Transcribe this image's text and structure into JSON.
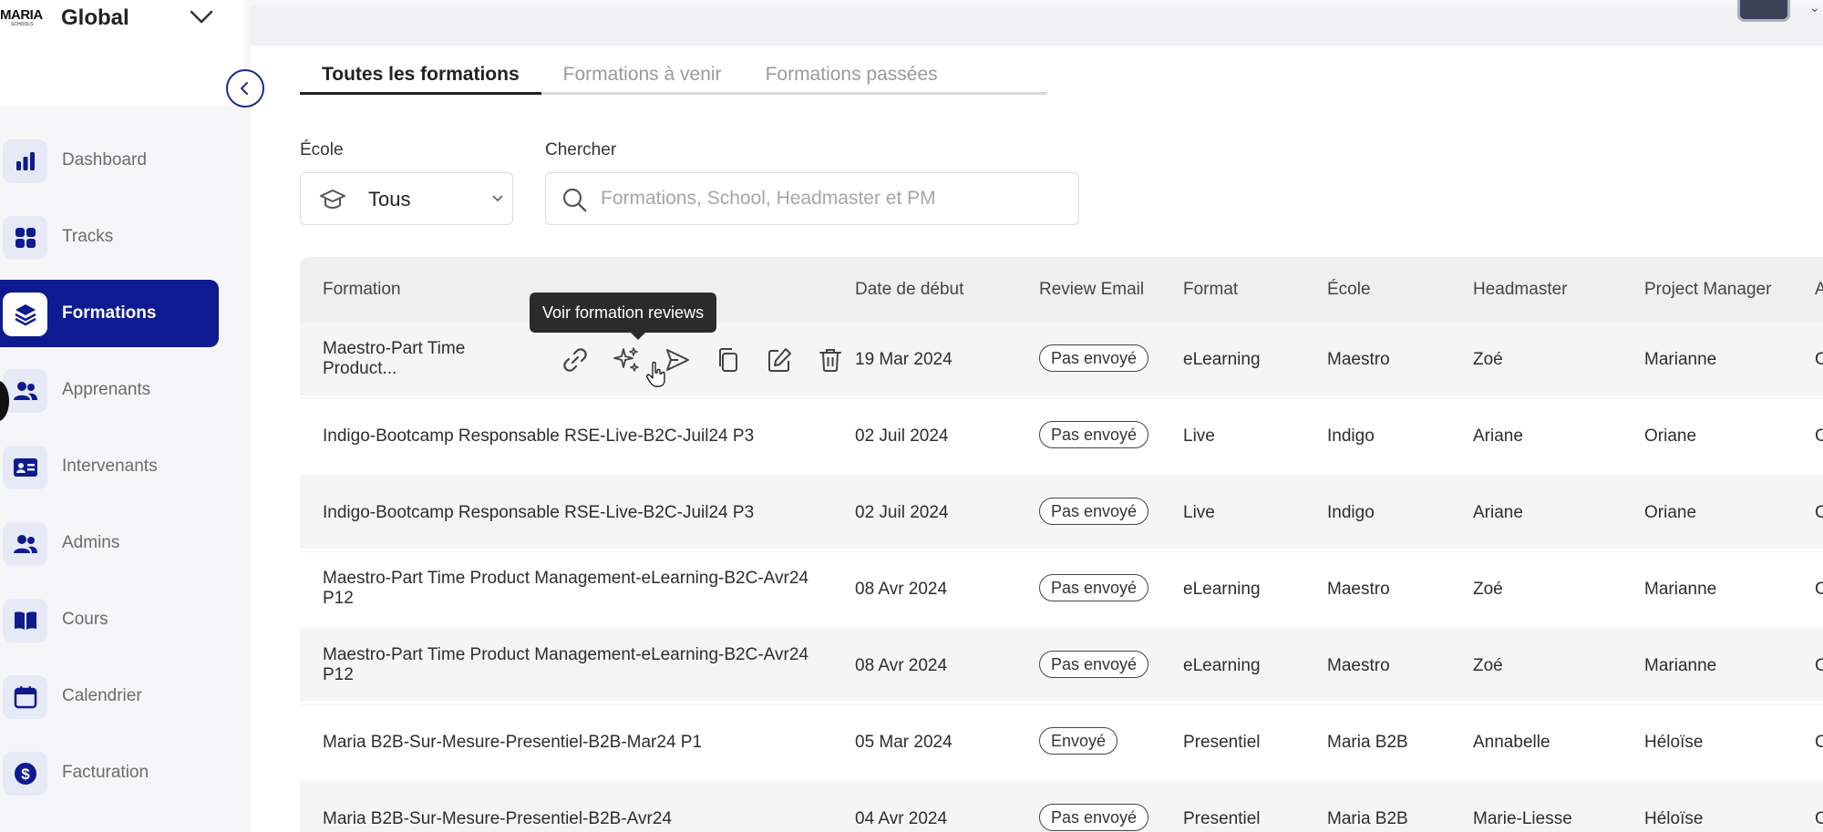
{
  "sidebar": {
    "logo": {
      "text": "MARIA",
      "subtext": "SCHOOLS"
    },
    "org_name": "Global",
    "items": [
      {
        "label": "Dashboard",
        "icon": "bar-chart-icon"
      },
      {
        "label": "Tracks",
        "icon": "grid-icon"
      },
      {
        "label": "Formations",
        "icon": "layers-icon",
        "active": true
      },
      {
        "label": "Apprenants",
        "icon": "users-icon"
      },
      {
        "label": "Intervenants",
        "icon": "id-card-icon"
      },
      {
        "label": "Admins",
        "icon": "users-icon"
      },
      {
        "label": "Cours",
        "icon": "book-icon"
      },
      {
        "label": "Calendrier",
        "icon": "calendar-icon"
      },
      {
        "label": "Facturation",
        "icon": "dollar-icon"
      }
    ]
  },
  "tabs": [
    {
      "label": "Toutes les formations",
      "active": true
    },
    {
      "label": "Formations à venir"
    },
    {
      "label": "Formations passées"
    }
  ],
  "filters": {
    "ecole_label": "École",
    "ecole_value": "Tous",
    "search_label": "Chercher",
    "search_placeholder": "Formations, School, Headmaster et PM"
  },
  "table": {
    "headers": [
      "Formation",
      "Date de début",
      "Review Email",
      "Format",
      "École",
      "Headmaster",
      "Project Manager",
      "A"
    ],
    "rows": [
      {
        "formation": "Maestro-Part Time Product...",
        "date": "19 Mar 2024",
        "review": "Pas envoyé",
        "format": "eLearning",
        "ecole": "Maestro",
        "headmaster": "Zoé",
        "pm": "Marianne",
        "extra": "C"
      },
      {
        "formation": "Indigo-Bootcamp Responsable RSE-Live-B2C-Juil24 P3",
        "date": "02 Juil 2024",
        "review": "Pas envoyé",
        "format": "Live",
        "ecole": "Indigo",
        "headmaster": "Ariane",
        "pm": "Oriane",
        "extra": "C"
      },
      {
        "formation": "Indigo-Bootcamp Responsable RSE-Live-B2C-Juil24 P3",
        "date": "02 Juil 2024",
        "review": "Pas envoyé",
        "format": "Live",
        "ecole": "Indigo",
        "headmaster": "Ariane",
        "pm": "Oriane",
        "extra": "C"
      },
      {
        "formation": "Maestro-Part Time Product Management-eLearning-B2C-Avr24 P12",
        "date": "08 Avr 2024",
        "review": "Pas envoyé",
        "format": "eLearning",
        "ecole": "Maestro",
        "headmaster": "Zoé",
        "pm": "Marianne",
        "extra": "C"
      },
      {
        "formation": "Maestro-Part Time Product Management-eLearning-B2C-Avr24 P12",
        "date": "08 Avr 2024",
        "review": "Pas envoyé",
        "format": "eLearning",
        "ecole": "Maestro",
        "headmaster": "Zoé",
        "pm": "Marianne",
        "extra": "C"
      },
      {
        "formation": "Maria B2B-Sur-Mesure-Presentiel-B2B-Mar24 P1",
        "date": "05 Mar 2024",
        "review": "Envoyé",
        "format": "Presentiel",
        "ecole": "Maria B2B",
        "headmaster": "Annabelle",
        "pm": "Héloïse",
        "extra": "C"
      },
      {
        "formation": "Maria B2B-Sur-Mesure-Presentiel-B2B-Avr24",
        "date": "04 Avr 2024",
        "review": "Pas envoyé",
        "format": "Presentiel",
        "ecole": "Maria B2B",
        "headmaster": "Marie-Liesse",
        "pm": "Héloïse",
        "extra": "C"
      }
    ]
  },
  "tooltip": "Voir formation reviews",
  "colors": {
    "primary": "#0e1a8f",
    "icon_bg": "#e7e9f6"
  }
}
